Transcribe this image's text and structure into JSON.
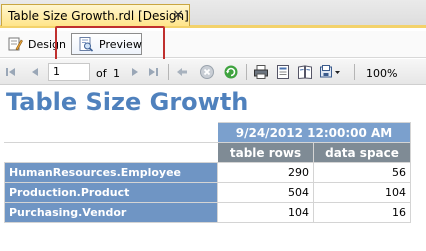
{
  "doc_tab": {
    "title": "Table Size Growth.rdl [Design]",
    "close_glyph": "×"
  },
  "view_tabs": [
    {
      "label": "Design",
      "icon": "design-icon"
    },
    {
      "label": "Preview",
      "icon": "preview-icon"
    }
  ],
  "toolbar": {
    "current_page": "1",
    "of_label": "of",
    "total_pages": "1",
    "zoom": "100%",
    "icons": [
      "first-page-icon",
      "previous-page-icon",
      "next-page-icon",
      "last-page-icon",
      "back-icon",
      "stop-icon",
      "refresh-icon",
      "print-icon",
      "print-layout-icon",
      "page-setup-icon",
      "export-icon"
    ]
  },
  "report": {
    "title": "Table Size Growth",
    "date_header": "9/24/2012 12:00:00 AM",
    "columns": [
      "table rows",
      "data space"
    ],
    "rows": [
      {
        "name": "HumanResources.Employee",
        "rows": "290",
        "space": "56"
      },
      {
        "name": "Production.Product",
        "rows": "504",
        "space": "104"
      },
      {
        "name": "Purchasing.Vendor",
        "rows": "104",
        "space": "16"
      }
    ]
  },
  "colors": {
    "title": "#4f81bd",
    "date_header_bg": "#7ba0cd",
    "column_header_bg": "#7f8b95",
    "row_header_bg": "#6f95c4",
    "highlight": "#c0302e",
    "active_tab": "#ffe58a"
  }
}
